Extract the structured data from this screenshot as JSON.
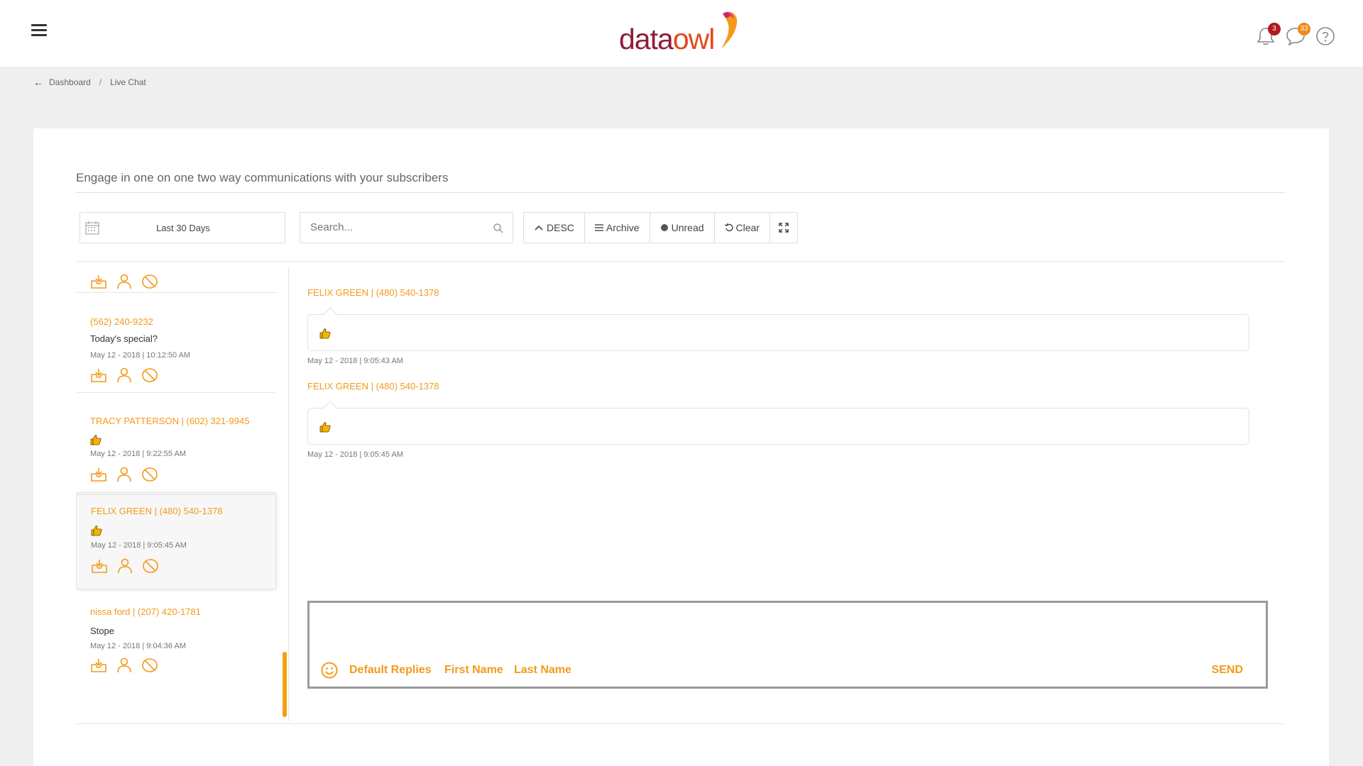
{
  "header": {
    "logo_data": "data",
    "logo_owl": "owl",
    "notifications_count": "3",
    "messages_count": "33"
  },
  "breadcrumb": {
    "items": [
      "Dashboard",
      "Live Chat"
    ]
  },
  "main": {
    "intro": "Engage in one on one two way communications with your subscribers",
    "date_range": "Last 30 Days",
    "search_placeholder": "Search...",
    "buttons": [
      "DESC",
      "Archive",
      "Unread",
      "Clear"
    ]
  },
  "conversations": [
    {
      "name": "(562) 240-9232",
      "message": "Today's special?",
      "time": "May 12 - 2018 | 10:12:50 AM"
    },
    {
      "name": "TRACY PATTERSON  |  (602) 321-9945",
      "message": "",
      "time": "May 12 - 2018 | 9:22:55 AM"
    },
    {
      "name": "FELIX GREEN  |  (480) 540-1378",
      "message": "",
      "time": "May 12 - 2018 | 9:05:45 AM"
    },
    {
      "name": "nissa ford  |  (207) 420-1781",
      "message": "Stope",
      "time": "May 12 - 2018 | 9:04:36 AM"
    }
  ],
  "chat": {
    "messages": [
      {
        "sender": "FELIX GREEN  |  (480) 540-1378",
        "time": "May 12 - 2018 | 9:05:43 AM"
      },
      {
        "sender": "FELIX GREEN  |  (480) 540-1378",
        "time": "May 12 - 2018 | 9:05:45 AM"
      }
    ]
  },
  "composer": {
    "default_replies": "Default Replies",
    "first_name": "First Name",
    "last_name": "Last Name",
    "send": "SEND"
  },
  "colors": {
    "accent": "#f39a1b",
    "brand_dark": "#8c1d3d",
    "brand_orange": "#e3491d"
  },
  "icons": {
    "menu": "hamburger-icon",
    "notifications": "bell-icon",
    "messages": "chat-bubble-icon",
    "help": "help-icon",
    "calendar": "calendar-icon",
    "search": "search-icon",
    "expand": "expand-icon",
    "emoji": "smiley-icon",
    "archive": "inbox-archive-icon",
    "contact": "person-icon",
    "block": "block-icon",
    "thumbs_up": "thumbs-up-icon"
  }
}
